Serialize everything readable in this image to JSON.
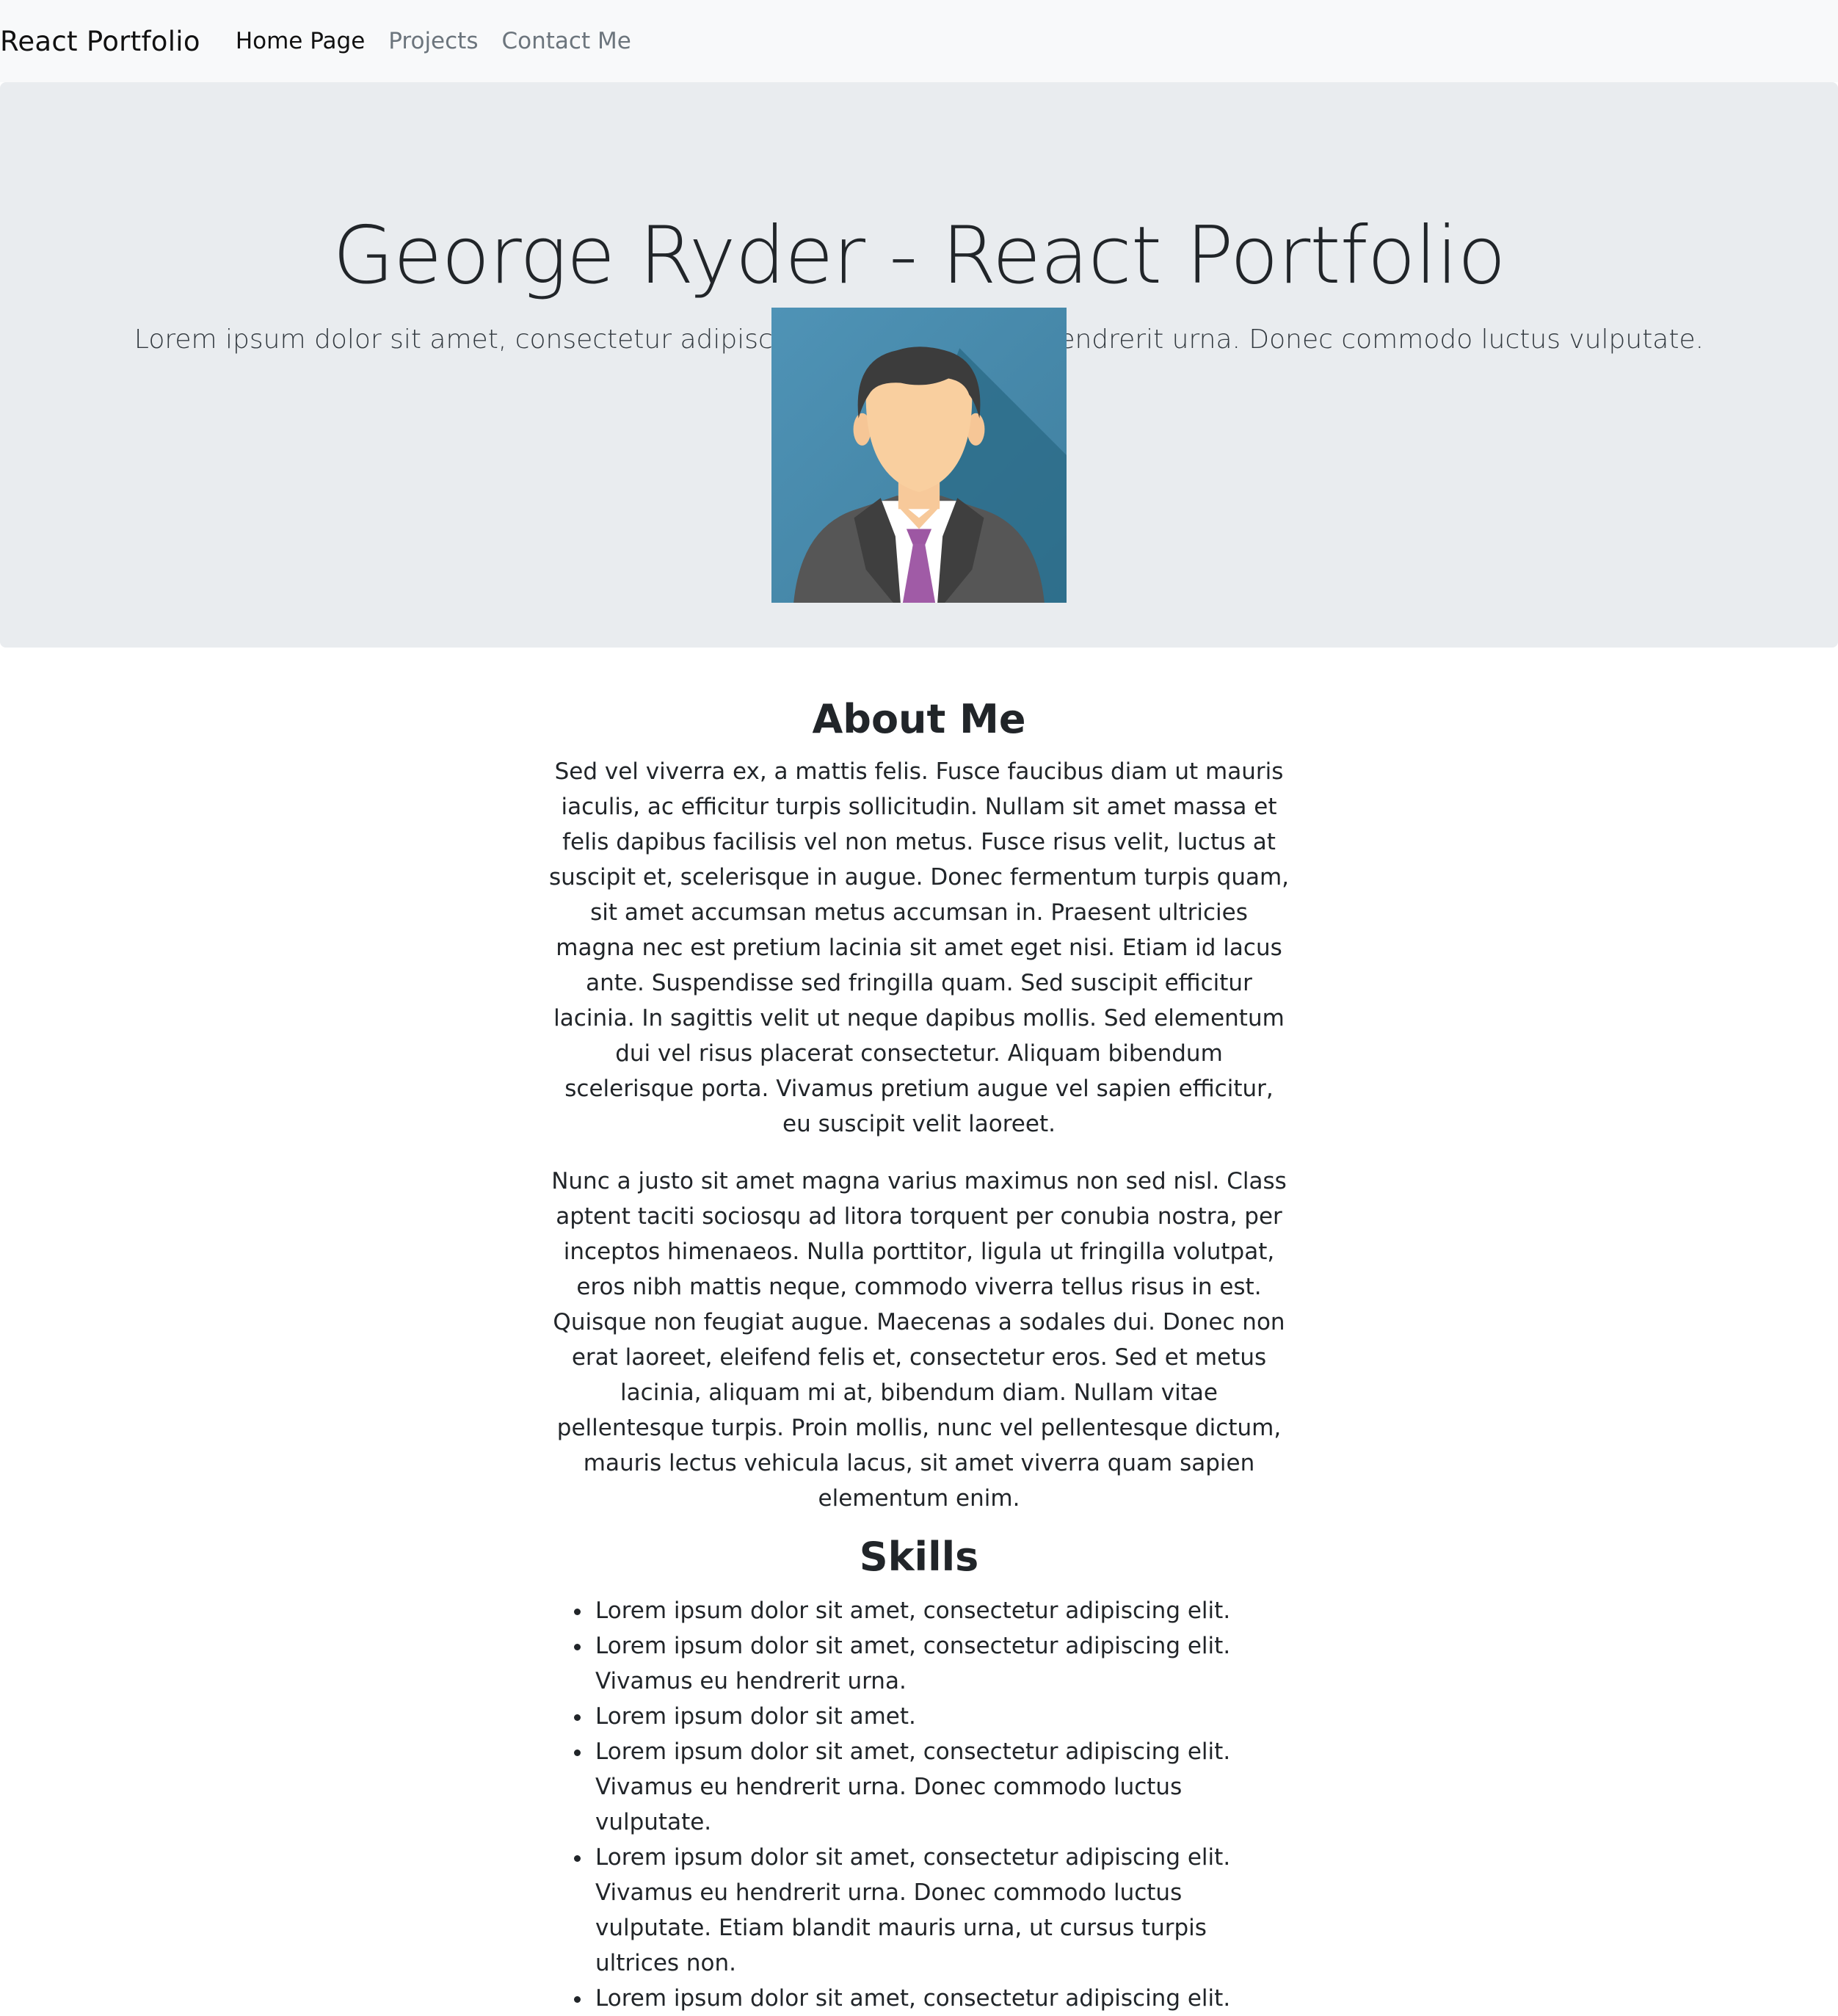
{
  "navbar": {
    "brand": "React Portfolio",
    "links": [
      {
        "label": "Home Page",
        "active": true
      },
      {
        "label": "Projects",
        "active": false
      },
      {
        "label": "Contact Me",
        "active": false
      }
    ]
  },
  "hero": {
    "title": "George Ryder - React Portfolio",
    "lead": "Lorem ipsum dolor sit amet, consectetur adipiscing elit. Vivamus eu hendrerit urna. Donec commodo luctus vulputate.",
    "avatar_icon": "businessman-avatar-icon"
  },
  "about": {
    "heading": "About Me",
    "paragraphs": [
      "Sed vel viverra ex, a mattis felis. Fusce faucibus diam ut mauris iaculis, ac efficitur turpis sollicitudin. Nullam sit amet massa et felis dapibus facilisis vel non metus. Fusce risus velit, luctus at suscipit et, scelerisque in augue. Donec fermentum turpis quam, sit amet accumsan metus accumsan in. Praesent ultricies magna nec est pretium lacinia sit amet eget nisi. Etiam id lacus ante. Suspendisse sed fringilla quam. Sed suscipit efficitur lacinia. In sagittis velit ut neque dapibus mollis. Sed elementum dui vel risus placerat consectetur. Aliquam bibendum scelerisque porta. Vivamus pretium augue vel sapien efficitur, eu suscipit velit laoreet.",
      "Nunc a justo sit amet magna varius maximus non sed nisl. Class aptent taciti sociosqu ad litora torquent per conubia nostra, per inceptos himenaeos. Nulla porttitor, ligula ut fringilla volutpat, eros nibh mattis neque, commodo viverra tellus risus in est. Quisque non feugiat augue. Maecenas a sodales dui. Donec non erat laoreet, eleifend felis et, consectetur eros. Sed et metus lacinia, aliquam mi at, bibendum diam. Nullam vitae pellentesque turpis. Proin mollis, nunc vel pellentesque dictum, mauris lectus vehicula lacus, sit amet viverra quam sapien elementum enim."
    ]
  },
  "skills": {
    "heading": "Skills",
    "items": [
      "Lorem ipsum dolor sit amet, consectetur adipiscing elit.",
      "Lorem ipsum dolor sit amet, consectetur adipiscing elit. Vivamus eu hendrerit urna.",
      "Lorem ipsum dolor sit amet.",
      "Lorem ipsum dolor sit amet, consectetur adipiscing elit. Vivamus eu hendrerit urna. Donec commodo luctus vulputate.",
      "Lorem ipsum dolor sit amet, consectetur adipiscing elit. Vivamus eu hendrerit urna. Donec commodo luctus vulputate. Etiam blandit mauris urna, ut cursus turpis ultrices non.",
      "Lorem ipsum dolor sit amet, consectetur adipiscing elit."
    ]
  },
  "colors": {
    "navbar_bg": "#f8f9fa",
    "jumbotron_bg": "#e9ecef",
    "text": "#212529",
    "muted_link": "#6c757d",
    "avatar_bg": "#4a8db0",
    "avatar_tie": "#a05ba6"
  }
}
